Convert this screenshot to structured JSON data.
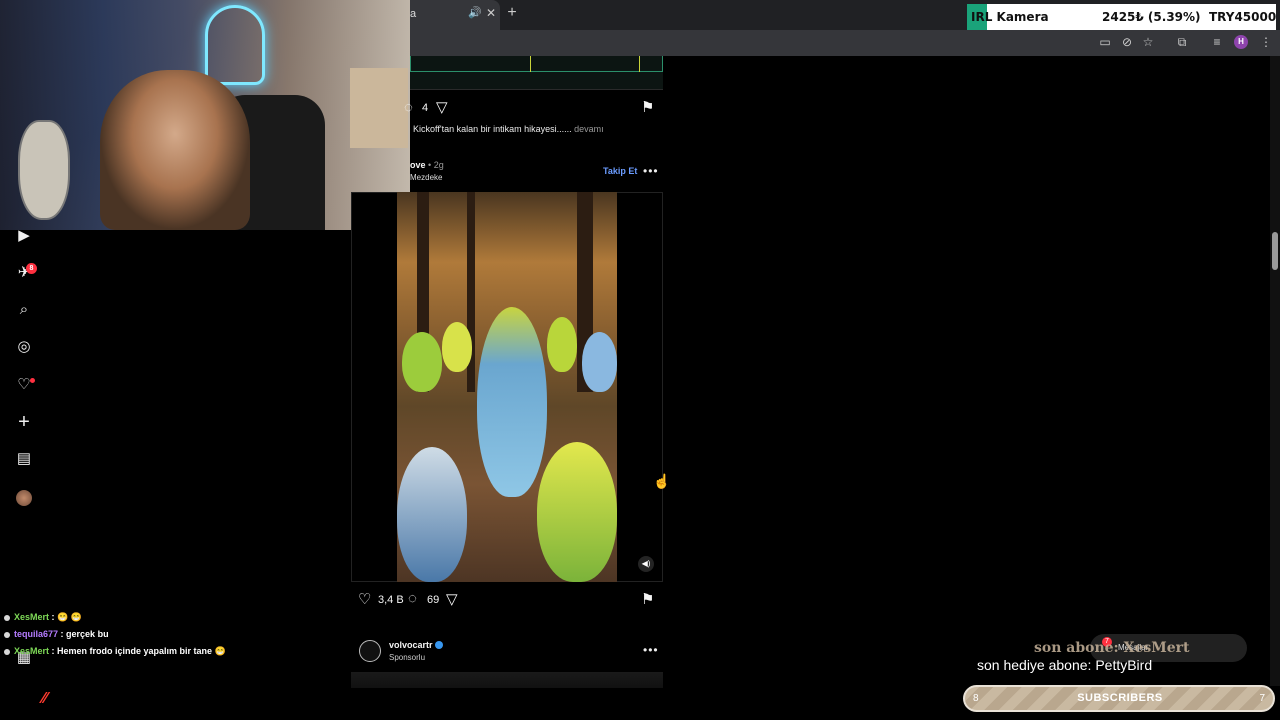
{
  "browser": {
    "tab_title": "a",
    "profile_initial": "H"
  },
  "ticker": {
    "name": "IRL Kamera",
    "price": "2425₺ (5.39%)",
    "goal": "TRY45000",
    "accent": "#1aa37a"
  },
  "sidebar": {
    "notifications_badge": "8"
  },
  "post1": {
    "comment_count": "4",
    "caption": "Kickoff'tan kalan bir intikam hikayesi......",
    "caption_more": "devamı"
  },
  "post2": {
    "author": "ove",
    "time": "2g",
    "audio": "Mezdeke",
    "follow_label": "Takip Et",
    "likes": "3,4 B",
    "comments": "69"
  },
  "post3": {
    "author": "volvocartr",
    "sponsored_label": "Sponsorlu"
  },
  "chat": [
    {
      "user": "XesMert",
      "user_color": "#7ed957",
      "message": ": 😁 😁"
    },
    {
      "user": "tequila677",
      "user_color": "#b57cff",
      "message": ": gerçek bu"
    },
    {
      "user": "XesMert",
      "user_color": "#7ed957",
      "message": ": Hemen frodo içinde yapalım bir tane 😁"
    }
  ],
  "overlay": {
    "sub_alert": "son abone: XesMert",
    "last_gift": "son hediye abone: PettyBird",
    "messages_label": "Mesajlar",
    "messages_count": "7",
    "sub_bar_left": "8",
    "sub_bar_label": "SUBSCRIBERS",
    "sub_bar_right": "7"
  }
}
